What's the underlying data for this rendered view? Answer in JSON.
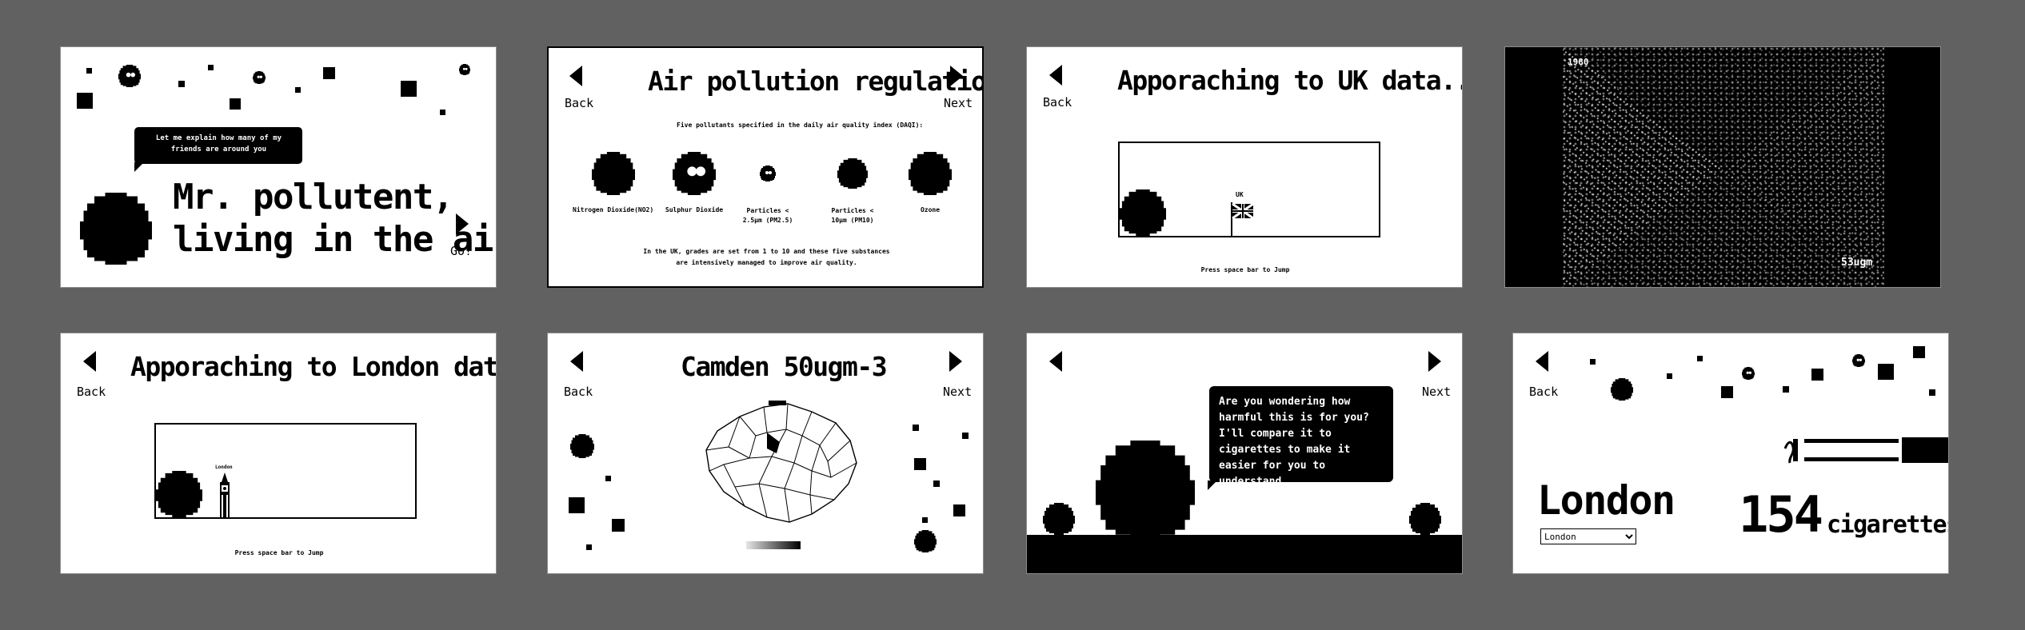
{
  "colors": {
    "background": "#616161",
    "panel": "#ffffff",
    "ink": "#000000"
  },
  "panel1": {
    "speech": "Let me explain how many of my friends are around you",
    "title_line1": "Mr. pollutent,",
    "title_line2": "living in the air",
    "go_label": "Go!"
  },
  "panel2": {
    "title": "Air pollution regulation",
    "back_label": "Back",
    "next_label": "Next",
    "subtitle": "Five pollutants specified in the daily air quality index (DAQI):",
    "pollutants": [
      "Nitrogen Dioxide(NO2)",
      "Sulphur Dioxide",
      "Particles < 2.5µm (PM2.5)",
      "Particles < 10µm (PM10)",
      "Ozone"
    ],
    "footnote_line1": "In the UK, grades are set from 1 to 10 and these five substances",
    "footnote_line2": "are intensively managed to improve air quality."
  },
  "panel3": {
    "title": "Apporaching to UK data...",
    "back_label": "Back",
    "flag_label": "UK",
    "hint": "Press space bar to Jump"
  },
  "panel4": {
    "year_label": "1980",
    "value_label": "53ugm"
  },
  "panel5": {
    "title": "Apporaching to London data...",
    "back_label": "Back",
    "tower_label": "London",
    "hint": "Press space bar to Jump"
  },
  "panel6": {
    "title": "Camden 50ugm-3",
    "back_label": "Back",
    "next_label": "Next"
  },
  "panel7": {
    "speech": "Are you wondering how harmful this is for you? I'll compare it to cigarettes to make it easier for you to understand ...",
    "next_label": "Next"
  },
  "panel8": {
    "back_label": "Back",
    "city": "London",
    "select_value": "London",
    "count": "154",
    "unit": "cigarettes"
  }
}
